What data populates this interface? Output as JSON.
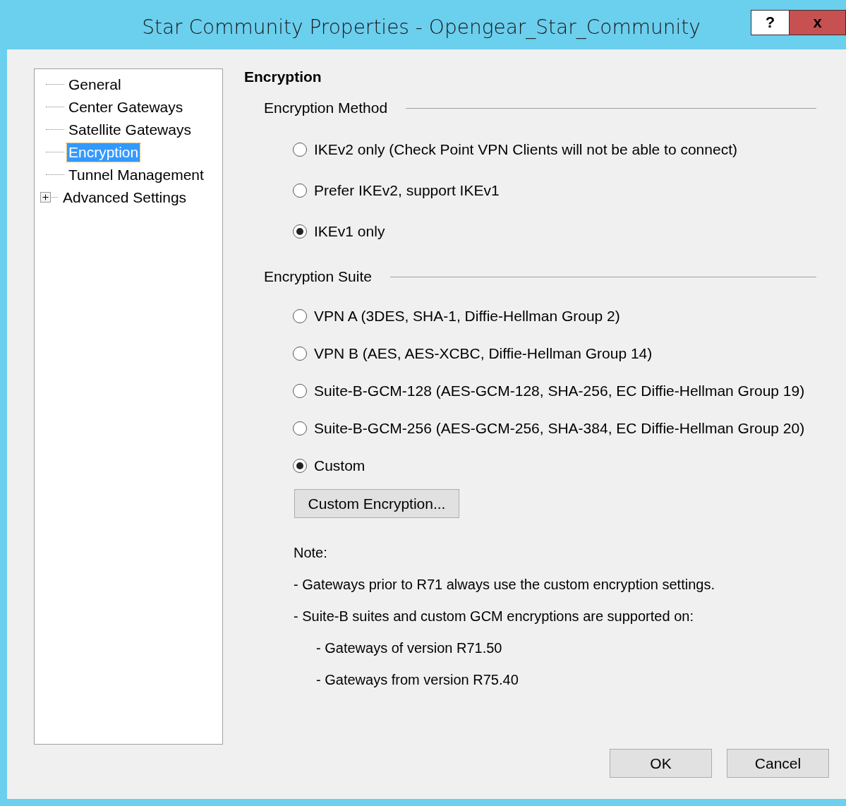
{
  "window": {
    "title": "Star Community Properties - Opengear_Star_Community",
    "help_button": "?",
    "close_button": "x"
  },
  "tree": {
    "items": [
      {
        "label": "General",
        "selected": false
      },
      {
        "label": "Center Gateways",
        "selected": false
      },
      {
        "label": "Satellite Gateways",
        "selected": false
      },
      {
        "label": "Encryption",
        "selected": true
      },
      {
        "label": "Tunnel Management",
        "selected": false
      },
      {
        "label": "Advanced Settings",
        "selected": false,
        "expanded": false
      }
    ]
  },
  "page_title": "Encryption",
  "groups": [
    {
      "title": "Encryption Method",
      "options": [
        {
          "label": "IKEv2 only (Check Point VPN Clients will not be able to connect)",
          "selected": false
        },
        {
          "label": "Prefer IKEv2, support IKEv1",
          "selected": false
        },
        {
          "label": "IKEv1 only",
          "selected": true
        }
      ]
    },
    {
      "title": "Encryption Suite",
      "options": [
        {
          "label": "VPN A (3DES, SHA-1, Diffie-Hellman Group 2)",
          "selected": false
        },
        {
          "label": "VPN B (AES, AES-XCBC, Diffie-Hellman Group 14)",
          "selected": false
        },
        {
          "label": "Suite-B-GCM-128 (AES-GCM-128, SHA-256, EC Diffie-Hellman Group 19)",
          "selected": false
        },
        {
          "label": "Suite-B-GCM-256 (AES-GCM-256, SHA-384, EC Diffie-Hellman Group 20)",
          "selected": false
        },
        {
          "label": "Custom",
          "selected": true
        }
      ],
      "button": "Custom Encryption..."
    }
  ],
  "note": {
    "title": "Note:",
    "lines": [
      {
        "text": "- Gateways prior to R71 always use the custom encryption settings."
      },
      {
        "text": "- Suite-B suites and custom GCM encryptions are supported on:",
        "children": [
          "- Gateways of version R71.50",
          "- Gateways from version R75.40"
        ]
      }
    ]
  },
  "buttons": [
    "OK",
    "Cancel"
  ]
}
